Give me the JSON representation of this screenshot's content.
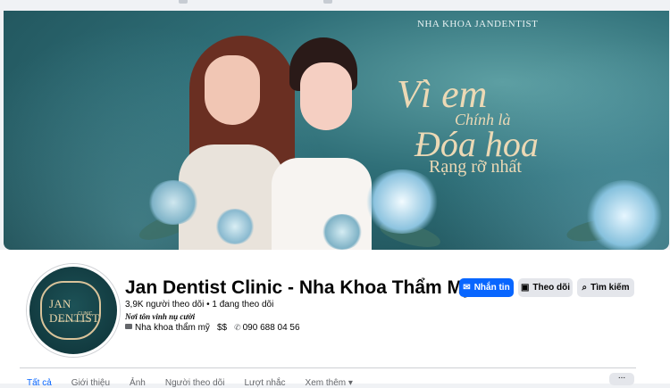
{
  "cover": {
    "brand": "NHA KHOA JANDENTIST",
    "slogan_line1": "Vì em",
    "slogan_line2": "Chính là",
    "slogan_line3": "Đóa hoa",
    "slogan_line4": "Rạng rỡ nhất"
  },
  "avatar": {
    "logo_text": "JAN DENTIST",
    "logo_sub": "CLINIC",
    "logo_tag": "Nơi tôn vinh nụ cười"
  },
  "page": {
    "name": "Jan Dentist Clinic - Nha Khoa Thẩm Mỹ",
    "followers": "3,9K người theo dõi • 1 đang theo dõi",
    "tagline": "Nơi tôn vinh nụ cười",
    "category": "Nha khoa thẩm mỹ",
    "price": "$$",
    "phone": "090 688 04 56"
  },
  "actions": {
    "message_label": "Nhắn tin",
    "follow_label": "Theo dõi",
    "search_label": "Tìm kiếm"
  },
  "tabs": [
    "Tất cả",
    "Giới thiệu",
    "Ảnh",
    "Người theo dõi",
    "Lượt nhắc",
    "Xem thêm ▾"
  ],
  "more_label": "...",
  "colors": {
    "primary": "#0866ff",
    "cover_teal": "#2f6f78",
    "gold": "#ecd9b5"
  }
}
